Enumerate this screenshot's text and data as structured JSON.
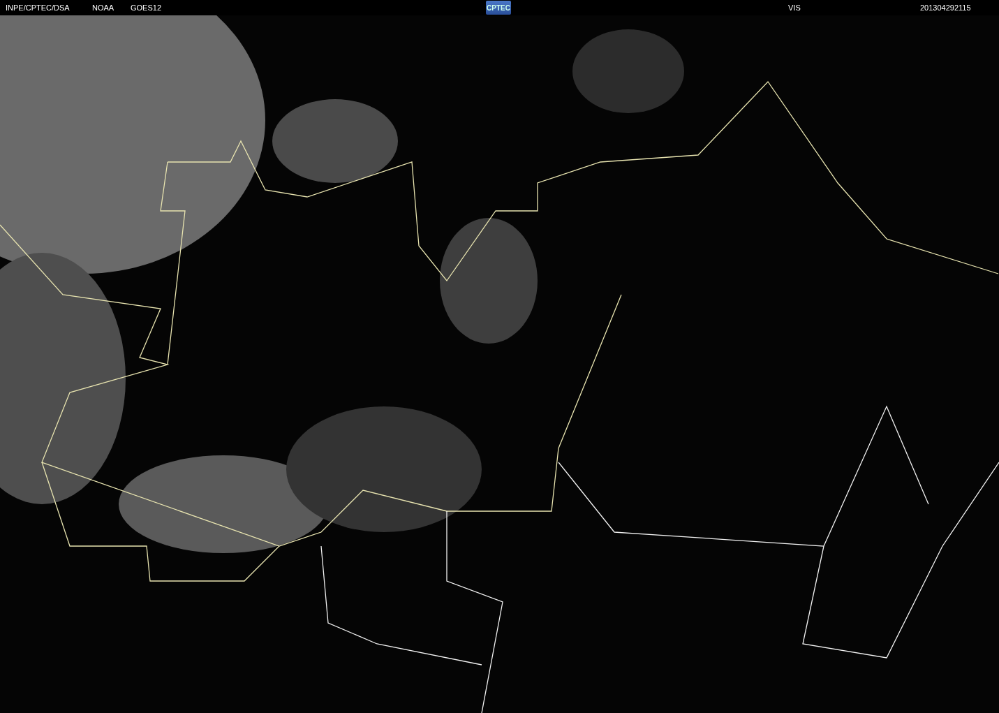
{
  "header": {
    "source": "INPE/CPTEC/DSA",
    "agency": "NOAA",
    "satellite": "GOES12",
    "logo": "CPTEC",
    "channel": "VIS",
    "timestamp": "201304292115"
  }
}
